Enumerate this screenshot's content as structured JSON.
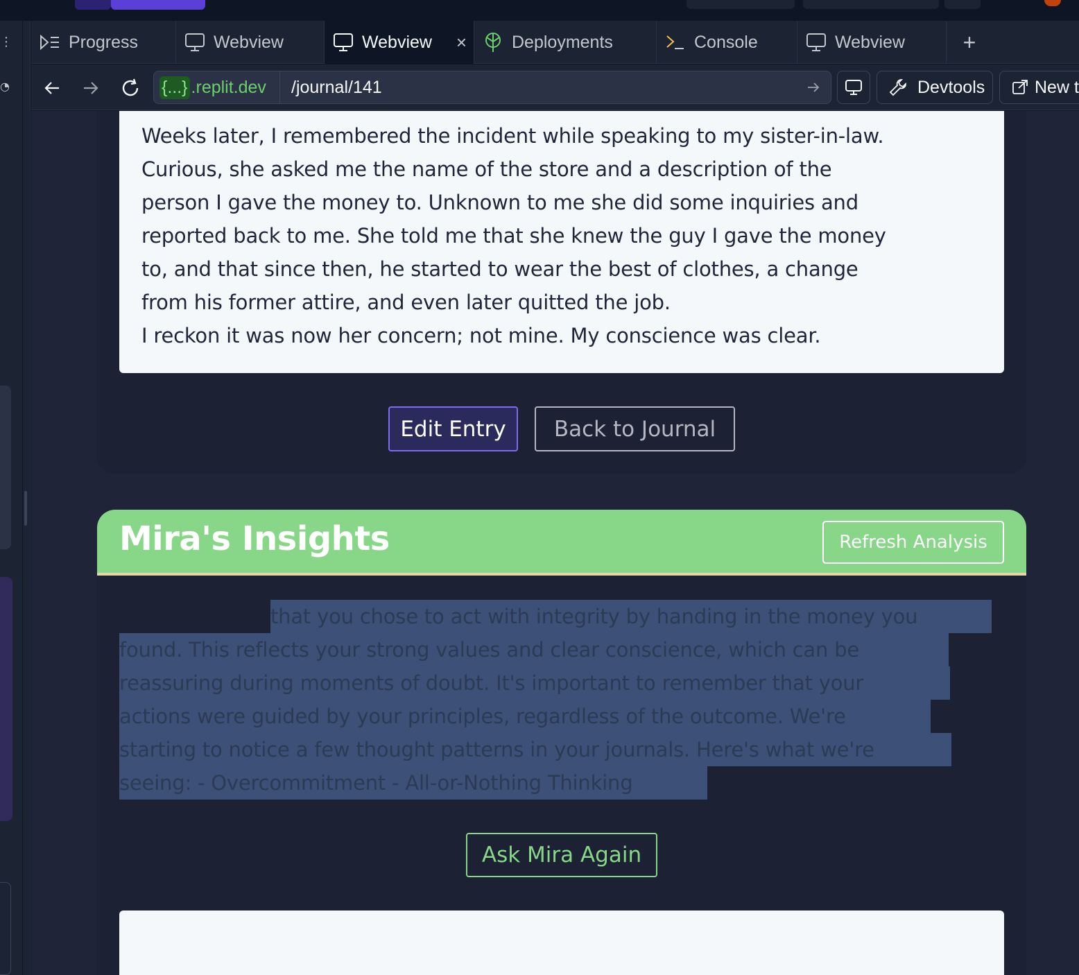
{
  "tabs": [
    {
      "label": "Progress",
      "icon": "progress-icon"
    },
    {
      "label": "Webview",
      "icon": "monitor-icon"
    },
    {
      "label": "Webview",
      "icon": "monitor-icon",
      "active": true,
      "close": "×"
    },
    {
      "label": "Deployments",
      "icon": "deployments-icon"
    },
    {
      "label": "Console",
      "icon": "console-icon"
    },
    {
      "label": "Webview",
      "icon": "monitor-icon"
    }
  ],
  "tab_add": "+",
  "address": {
    "domain_braces": "{...}",
    "domain_suffix": ".replit.dev",
    "path": "/journal/141"
  },
  "toolbar": {
    "devtools_label": "Devtools",
    "newtab_label": "New ta"
  },
  "entry": {
    "lines": [
      "Weeks later, I remembered the incident while speaking to my sister-in-law.",
      "Curious, she asked me the name of the store and a description of the",
      "person I gave the money to. Unknown to me she did some inquiries and",
      "reported back to me. She told me that she knew the guy I gave the money",
      "to, and that since then, he started to wear the best of clothes, a change",
      "from his former attire, and even later quitted the job.",
      "I reckon it was now her concern; not mine. My conscience was clear."
    ],
    "edit_label": "Edit Entry",
    "back_label": "Back to Journal"
  },
  "insights": {
    "title": "Mira's Insights",
    "refresh_label": "Refresh Analysis",
    "lines": [
      "that you chose to act with integrity by handing in the money you",
      "found. This reflects your strong values and clear conscience, which can be",
      "reassuring during moments of doubt. It's important to remember that your",
      "actions were guided by your principles, regardless of the outcome. We're",
      "starting to notice a few thought patterns in your journals. Here's what we're",
      "seeing: - Overcommitment - All-or-Nothing Thinking"
    ],
    "ask_label": "Ask Mira Again"
  },
  "colors": {
    "accent_green": "#88d788",
    "accent_purple": "#7b6cf0",
    "selection": "#3d5178"
  }
}
